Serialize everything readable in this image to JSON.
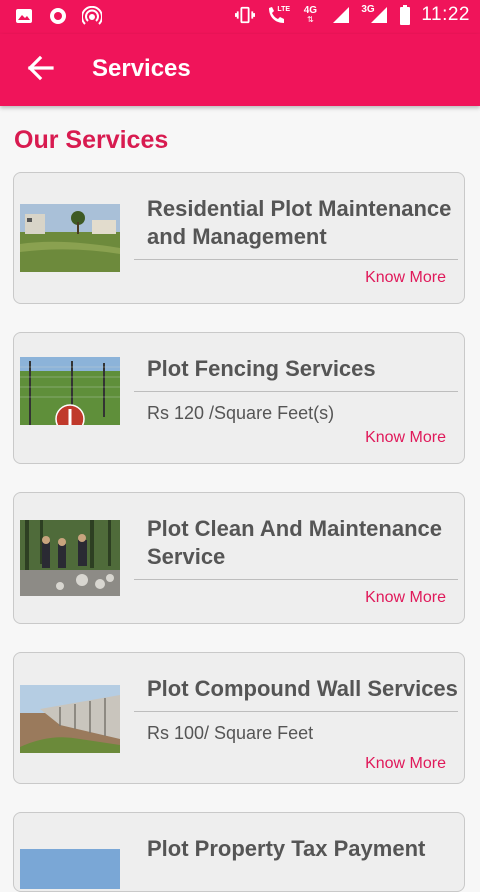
{
  "status_bar": {
    "time": "11:22",
    "lte_label": "LTE",
    "net_4g": "4G",
    "net_3g": "3G",
    "left_icons": [
      "image-icon",
      "circle-icon",
      "hotspot-icon"
    ],
    "right_icons": [
      "vibrate-icon",
      "call-lte-icon",
      "signal-icon",
      "signal-icon",
      "battery-icon"
    ]
  },
  "app_bar": {
    "title": "Services",
    "back_icon": "arrow-left-icon"
  },
  "section": {
    "title": "Our Services"
  },
  "services": [
    {
      "title": "Residential Plot Maintenance and Management",
      "price": "",
      "link": "Know More",
      "image": "residential-plot"
    },
    {
      "title": "Plot Fencing Services",
      "price": "Rs 120 /Square Feet(s)",
      "link": "Know More",
      "image": "plot-fencing"
    },
    {
      "title": "Plot Clean And Maintenance Service",
      "price": "",
      "link": "Know More",
      "image": "plot-clean"
    },
    {
      "title": "Plot Compound Wall Services",
      "price": "Rs 100/ Square Feet",
      "link": "Know More",
      "image": "compound-wall"
    },
    {
      "title": "Plot Property Tax Payment",
      "price": "",
      "link": "",
      "image": "property-tax"
    }
  ],
  "colors": {
    "primary": "#f0145a",
    "accent": "#d81b50",
    "card_bg": "#eeeeee",
    "text": "#555555"
  }
}
